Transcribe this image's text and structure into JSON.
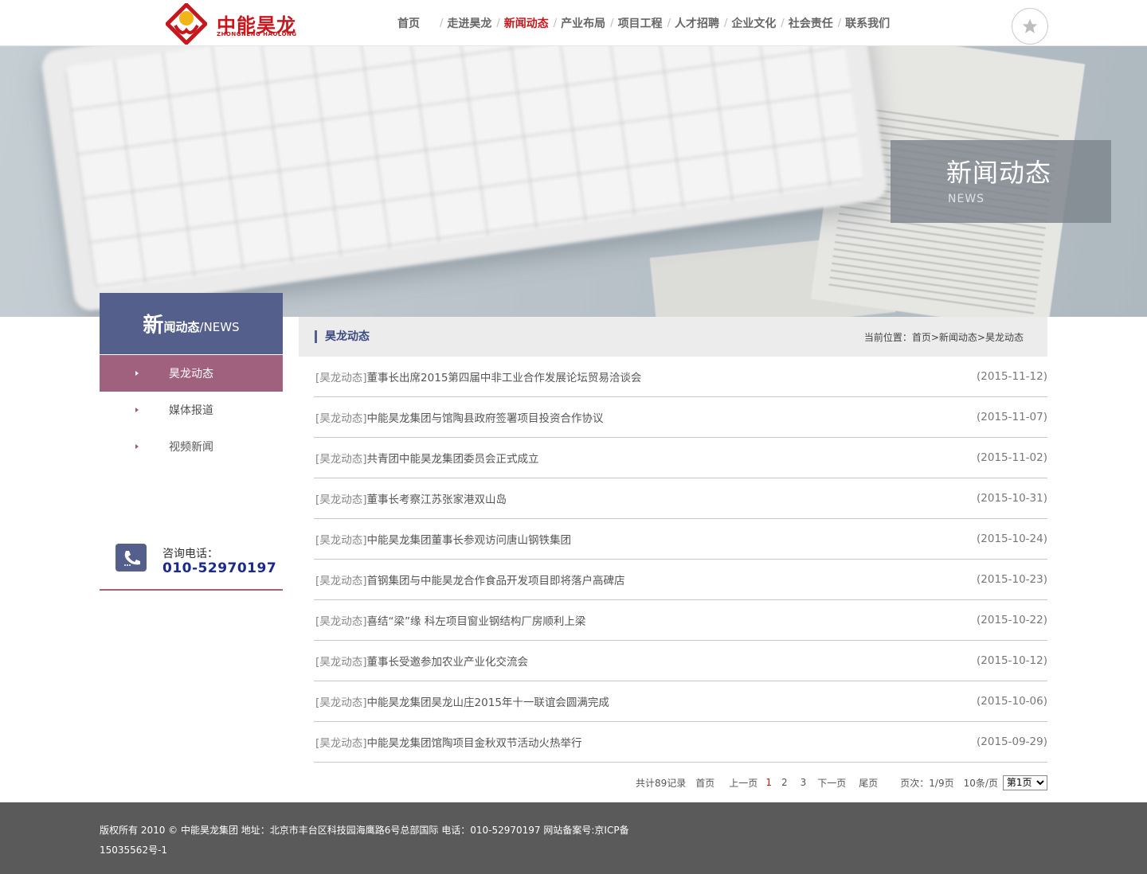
{
  "brand": {
    "name_cn": "中能昊龙",
    "name_en": "ZHONGNENG HAOLONG",
    "logo_color": "#c8161d"
  },
  "nav": {
    "items": [
      {
        "label": "首页"
      },
      {
        "label": "走进昊龙"
      },
      {
        "label": "新闻动态",
        "active": true
      },
      {
        "label": "产业布局"
      },
      {
        "label": "项目工程"
      },
      {
        "label": "人才招聘"
      },
      {
        "label": "企业文化"
      },
      {
        "label": "社会责任"
      },
      {
        "label": "联系我们"
      }
    ],
    "separator": "/",
    "favorite_icon": "star-icon"
  },
  "banner": {
    "title": "新闻动态",
    "subtitle": "NEWS"
  },
  "sidebar": {
    "head_big": "新",
    "head_rest": "闻动态",
    "head_en": "/NEWS",
    "items": [
      {
        "label": "昊龙动态",
        "active": true
      },
      {
        "label": "媒体报道"
      },
      {
        "label": "视频新闻"
      }
    ],
    "contact_label": "咨询电话：",
    "contact_phone": "010-52970197",
    "contact_icon": "phone-icon",
    "accent": "#a0617f",
    "head_color": "#555f8b"
  },
  "content": {
    "section_title": "昊龙动态",
    "breadcrumb": {
      "prefix": "当前位置：",
      "items": [
        "首页",
        "新闻动态",
        "昊龙动态"
      ],
      "sep": ">"
    },
    "news": [
      {
        "category": "[昊龙动态]",
        "title": "董事长出席2015第四届中非工业合作发展论坛贸易洽谈会",
        "date": "(2015-11-12)"
      },
      {
        "category": "[昊龙动态]",
        "title": "中能昊龙集团与馆陶县政府签署项目投资合作协议",
        "date": "(2015-11-07)"
      },
      {
        "category": "[昊龙动态]",
        "title": "共青团中能昊龙集团委员会正式成立",
        "date": "(2015-11-02)"
      },
      {
        "category": "[昊龙动态]",
        "title": "董事长考察江苏张家港双山岛",
        "date": "(2015-10-31)"
      },
      {
        "category": "[昊龙动态]",
        "title": "中能昊龙集团董事长参观访问唐山钢铁集团",
        "date": "(2015-10-24)"
      },
      {
        "category": "[昊龙动态]",
        "title": "首钢集团与中能昊龙合作食品开发项目即将落户高碑店",
        "date": "(2015-10-23)"
      },
      {
        "category": "[昊龙动态]",
        "title": "喜结“梁”缘 科左项目窗业钢结构厂房顺利上梁",
        "date": "(2015-10-22)"
      },
      {
        "category": "[昊龙动态]",
        "title": "董事长受邀参加农业产业化交流会",
        "date": "(2015-10-12)"
      },
      {
        "category": "[昊龙动态]",
        "title": "中能昊龙集团昊龙山庄2015年十一联谊会圆满完成",
        "date": "(2015-10-06)"
      },
      {
        "category": "[昊龙动态]",
        "title": "中能昊龙集团馆陶项目金秋双节活动火热举行",
        "date": "(2015-09-29)"
      }
    ],
    "pager": {
      "total": "共计89记录",
      "first": "首页",
      "prev": "上一页",
      "pages": [
        "1",
        "2",
        "3"
      ],
      "current_page": "1",
      "next": "下一页",
      "last": "尾页",
      "page_info": "页次：1/9页",
      "per_page": "10条/页",
      "select_value": "第1页"
    }
  },
  "footer": {
    "line1": "版权所有 2010 © 中能昊龙集团 地址：北京市丰台区科技园海鹰路6号总部国际 电话：010-52970197    网站备案号:京ICP备",
    "line2": "15035562号-1"
  }
}
